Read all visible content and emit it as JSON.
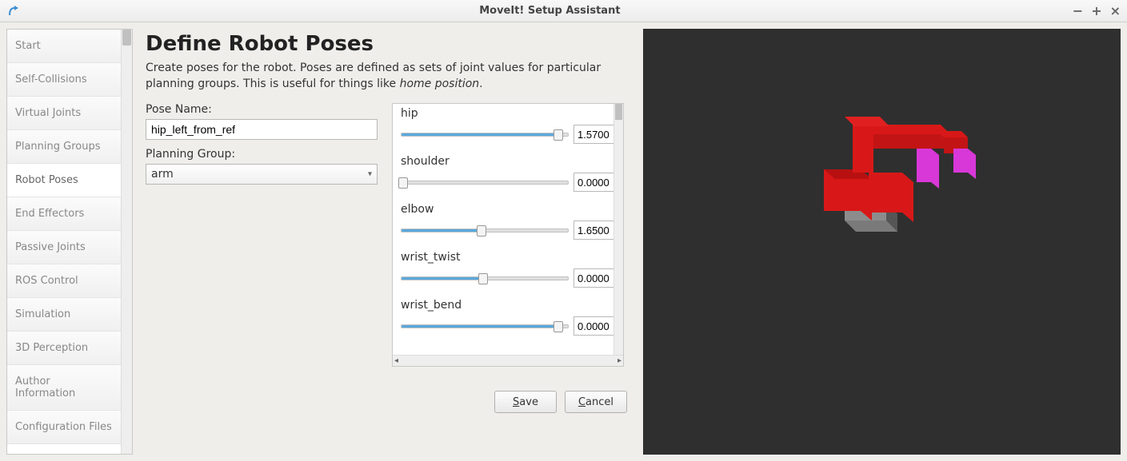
{
  "window": {
    "title": "MoveIt! Setup Assistant"
  },
  "sidebar": {
    "items": [
      {
        "label": "Start"
      },
      {
        "label": "Self-Collisions"
      },
      {
        "label": "Virtual Joints"
      },
      {
        "label": "Planning Groups"
      },
      {
        "label": "Robot Poses",
        "selected": true
      },
      {
        "label": "End Effectors"
      },
      {
        "label": "Passive Joints"
      },
      {
        "label": "ROS Control"
      },
      {
        "label": "Simulation"
      },
      {
        "label": "3D Perception"
      },
      {
        "label": "Author Information"
      },
      {
        "label": "Configuration Files"
      }
    ]
  },
  "page": {
    "heading": "Define Robot Poses",
    "description_prefix": "Create poses for the robot. Poses are defined as sets of joint values for particular planning groups. This is useful for things like ",
    "description_em": "home position",
    "description_suffix": "."
  },
  "form": {
    "pose_name_label": "Pose Name:",
    "pose_name_value": "hip_left_from_ref",
    "planning_group_label": "Planning Group:",
    "planning_group_value": "arm"
  },
  "joints": [
    {
      "name": "hip",
      "value": "1.5700",
      "percent": 94
    },
    {
      "name": "shoulder",
      "value": "0.0000",
      "percent": 1
    },
    {
      "name": "elbow",
      "value": "1.6500",
      "percent": 48
    },
    {
      "name": "wrist_twist",
      "value": "0.0000",
      "percent": 49
    },
    {
      "name": "wrist_bend",
      "value": "0.0000",
      "percent": 94
    }
  ],
  "buttons": {
    "save": "Save",
    "cancel": "Cancel"
  }
}
